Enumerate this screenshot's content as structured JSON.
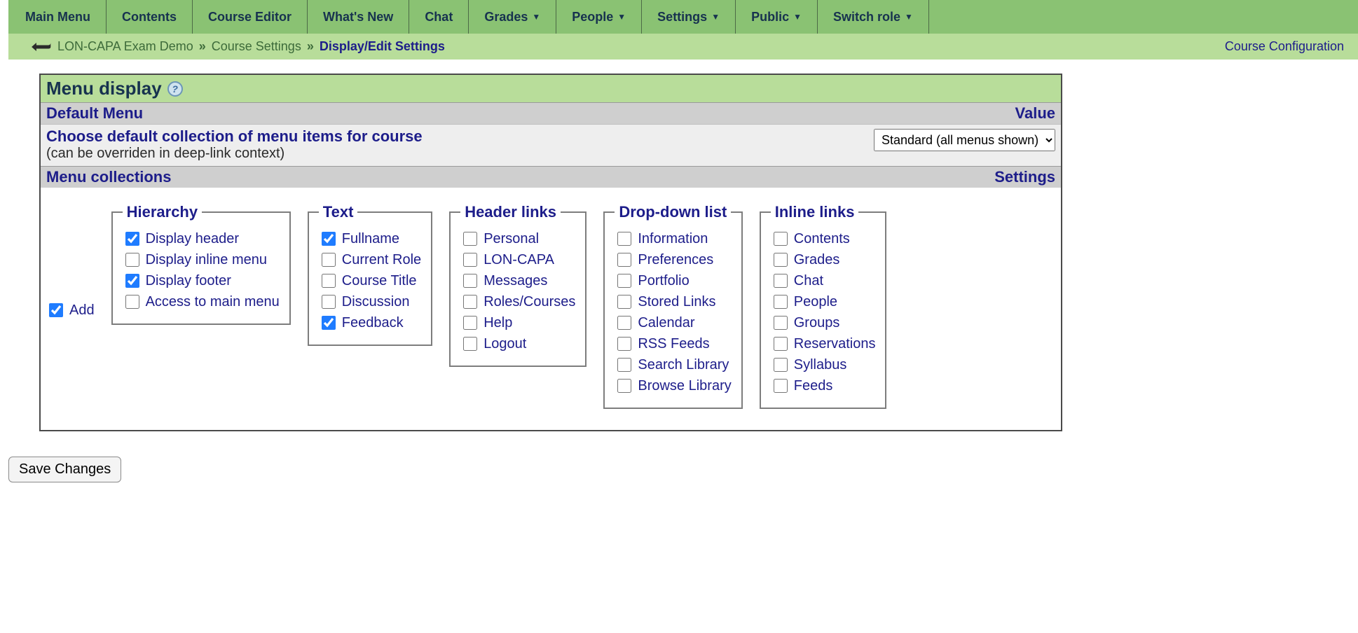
{
  "topmenu": {
    "items": [
      {
        "label": "Main Menu",
        "dropdown": false
      },
      {
        "label": "Contents",
        "dropdown": false
      },
      {
        "label": "Course Editor",
        "dropdown": false
      },
      {
        "label": "What's New",
        "dropdown": false
      },
      {
        "label": "Chat",
        "dropdown": false
      },
      {
        "label": "Grades",
        "dropdown": true
      },
      {
        "label": "People",
        "dropdown": true
      },
      {
        "label": "Settings",
        "dropdown": true
      },
      {
        "label": "Public",
        "dropdown": true
      },
      {
        "label": "Switch role",
        "dropdown": true
      }
    ]
  },
  "breadcrumb": {
    "course": "LON-CAPA Exam Demo",
    "mid": "Course Settings",
    "current": "Display/Edit Settings",
    "page_title": "Course Configuration",
    "sep": "»"
  },
  "panel": {
    "title": "Menu display",
    "default_menu_label": "Default Menu",
    "value_label": "Value",
    "choose_line1": "Choose default collection of menu items for course",
    "choose_line2": "(can be overriden in deep-link context)",
    "select_value": "Standard (all menus shown)",
    "collections_label": "Menu collections",
    "settings_label": "Settings",
    "add_label": "Add",
    "add_checked": true
  },
  "groups": {
    "hierarchy": {
      "legend": "Hierarchy",
      "items": [
        {
          "label": "Display header",
          "checked": true
        },
        {
          "label": "Display inline menu",
          "checked": false
        },
        {
          "label": "Display footer",
          "checked": true
        },
        {
          "label": "Access to main menu",
          "checked": false
        }
      ]
    },
    "text": {
      "legend": "Text",
      "items": [
        {
          "label": "Fullname",
          "checked": true
        },
        {
          "label": "Current Role",
          "checked": false
        },
        {
          "label": "Course Title",
          "checked": false
        },
        {
          "label": "Discussion",
          "checked": false
        },
        {
          "label": "Feedback",
          "checked": true
        }
      ]
    },
    "header_links": {
      "legend": "Header links",
      "items": [
        {
          "label": "Personal",
          "checked": false
        },
        {
          "label": "LON-CAPA",
          "checked": false
        },
        {
          "label": "Messages",
          "checked": false
        },
        {
          "label": "Roles/Courses",
          "checked": false
        },
        {
          "label": "Help",
          "checked": false
        },
        {
          "label": "Logout",
          "checked": false
        }
      ]
    },
    "dropdown": {
      "legend": "Drop-down list",
      "items": [
        {
          "label": "Information",
          "checked": false
        },
        {
          "label": "Preferences",
          "checked": false
        },
        {
          "label": "Portfolio",
          "checked": false
        },
        {
          "label": "Stored Links",
          "checked": false
        },
        {
          "label": "Calendar",
          "checked": false
        },
        {
          "label": "RSS Feeds",
          "checked": false
        },
        {
          "label": "Search Library",
          "checked": false
        },
        {
          "label": "Browse Library",
          "checked": false
        }
      ]
    },
    "inline": {
      "legend": "Inline links",
      "items": [
        {
          "label": "Contents",
          "checked": false
        },
        {
          "label": "Grades",
          "checked": false
        },
        {
          "label": "Chat",
          "checked": false
        },
        {
          "label": "People",
          "checked": false
        },
        {
          "label": "Groups",
          "checked": false
        },
        {
          "label": "Reservations",
          "checked": false
        },
        {
          "label": "Syllabus",
          "checked": false
        },
        {
          "label": "Feeds",
          "checked": false
        }
      ]
    }
  },
  "save_label": "Save Changes"
}
